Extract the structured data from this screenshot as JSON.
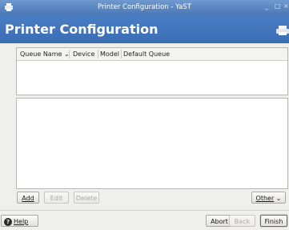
{
  "window": {
    "title": "Printer Configuration - YaST",
    "minimize_glyph": "_",
    "maximize_glyph": "□",
    "close_glyph": "×"
  },
  "banner": {
    "title": "Printer Configuration",
    "icon": "printer-icon"
  },
  "table": {
    "columns": [
      "Queue Name",
      "Device",
      "Model",
      "Default Queue"
    ],
    "sort_indicator": "⌄",
    "rows": []
  },
  "buttons": {
    "add": "Add",
    "edit": "Edit",
    "delete": "Delete",
    "other": "Other",
    "other_arrow": "⌄",
    "help": "Help",
    "abort": "Abort",
    "back": "Back",
    "finish": "Finish"
  },
  "colors": {
    "banner": "#3a6db3",
    "titlebar": "#4a78b6",
    "panel": "#efefed"
  }
}
